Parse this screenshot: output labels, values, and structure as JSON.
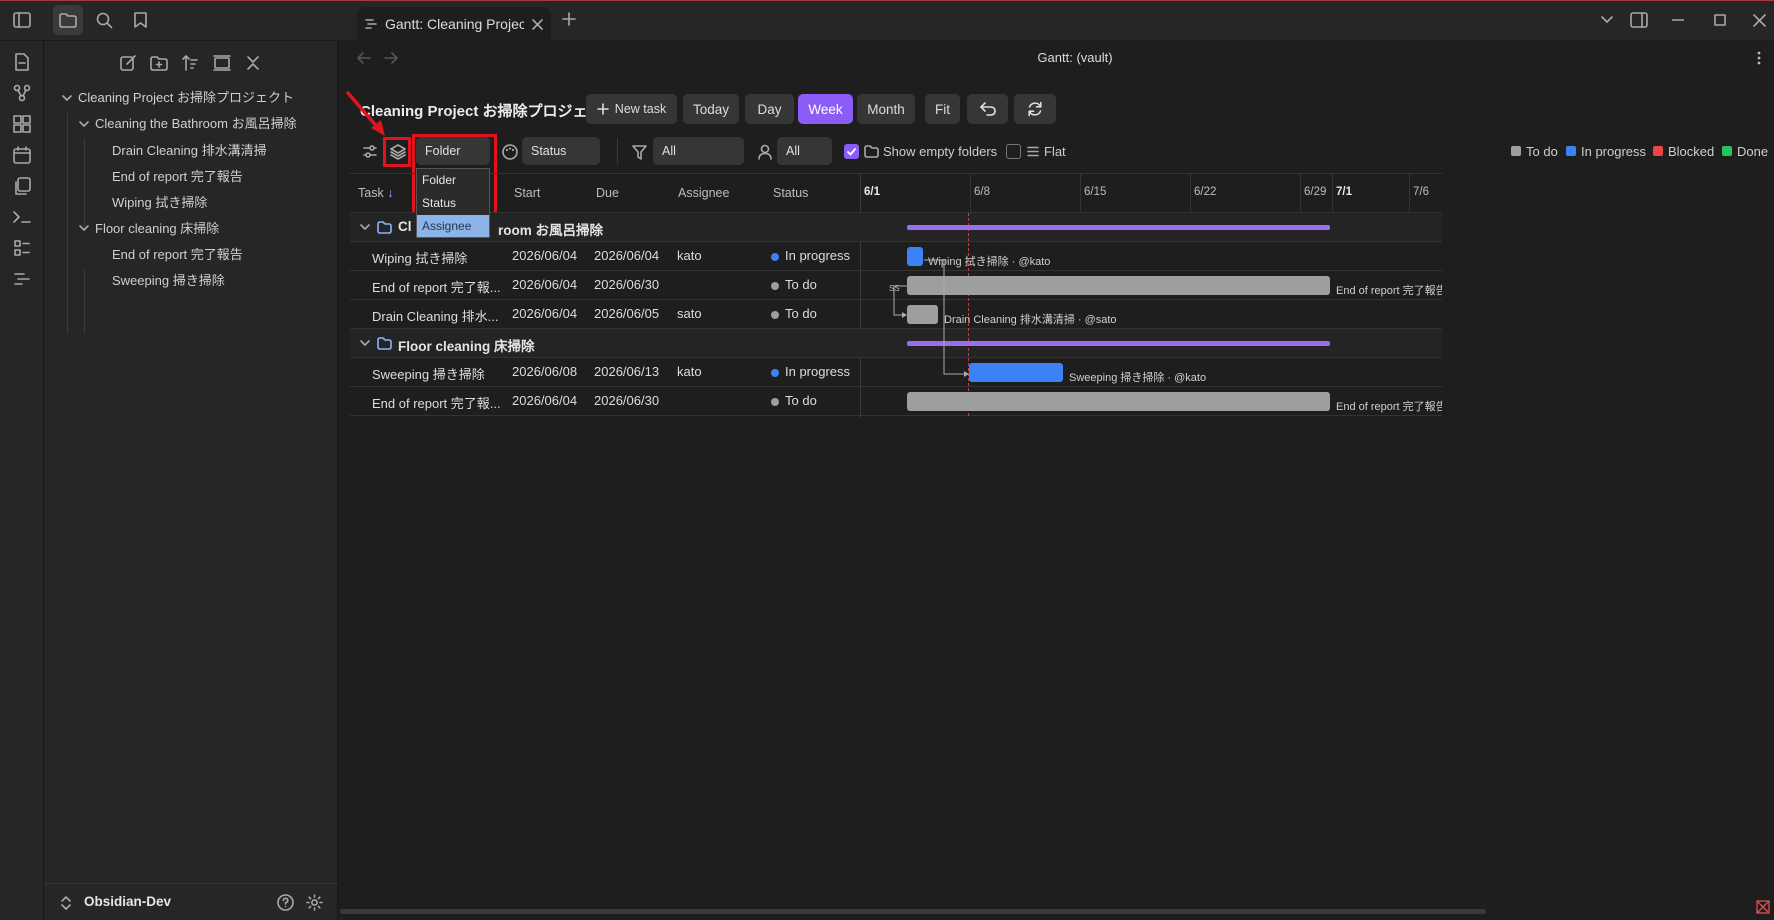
{
  "tab": {
    "title": "Gantt: Cleaning Project..."
  },
  "nav": {
    "title": "Gantt: (vault)"
  },
  "sidebar": {
    "tree": [
      {
        "label": "Cleaning Project お掃除プロジェクト"
      },
      {
        "label": "Cleaning the Bathroom お風呂掃除"
      },
      {
        "label": "Drain Cleaning 排水溝清掃"
      },
      {
        "label": "End of report 完了報告"
      },
      {
        "label": "Wiping 拭き掃除"
      },
      {
        "label": "Floor cleaning 床掃除"
      },
      {
        "label": "End of report 完了報告"
      },
      {
        "label": "Sweeping 掃き掃除"
      }
    ],
    "vault": "Obsidian-Dev"
  },
  "toolbar": {
    "title": "Cleaning Project お掃除プロジェクト",
    "new_task": "New task",
    "today": "Today",
    "day": "Day",
    "week": "Week",
    "month": "Month",
    "fit": "Fit"
  },
  "filters": {
    "group_by": "Folder",
    "color_by": "Status",
    "filter": "All",
    "assignee": "All",
    "show_empty_folders": "Show empty folders",
    "flat": "Flat",
    "group_options": [
      "Folder",
      "Status",
      "Assignee"
    ]
  },
  "legend": [
    {
      "label": "To do",
      "color": "#9e9e9e"
    },
    {
      "label": "In progress",
      "color": "#3b82f6"
    },
    {
      "label": "Blocked",
      "color": "#ef4444"
    },
    {
      "label": "Done",
      "color": "#22c55e"
    }
  ],
  "table": {
    "headers": {
      "task": "Task",
      "sort": "↓",
      "start": "Start",
      "due": "Due",
      "assignee": "Assignee",
      "status": "Status"
    },
    "groups": [
      {
        "label": "Cleaning the Bathroom お風呂掃除",
        "visible_label": "room お風呂掃除",
        "cl": "Cl"
      },
      {
        "label": "Floor cleaning 床掃除"
      }
    ],
    "rows": [
      {
        "task": "Wiping 拭き掃除",
        "start": "2026/06/04",
        "due": "2026/06/04",
        "assignee": "kato",
        "status": "In progress",
        "status_color": "#3b82f6"
      },
      {
        "task": "End of report 完了報...",
        "start": "2026/06/04",
        "due": "2026/06/30",
        "assignee": "",
        "status": "To do",
        "status_color": "#9e9e9e"
      },
      {
        "task": "Drain Cleaning 排水...",
        "start": "2026/06/04",
        "due": "2026/06/05",
        "assignee": "sato",
        "status": "To do",
        "status_color": "#9e9e9e"
      },
      {
        "task": "Sweeping 掃き掃除",
        "start": "2026/06/08",
        "due": "2026/06/13",
        "assignee": "kato",
        "status": "In progress",
        "status_color": "#3b82f6"
      },
      {
        "task": "End of report 完了報...",
        "start": "2026/06/04",
        "due": "2026/06/30",
        "assignee": "",
        "status": "To do",
        "status_color": "#9e9e9e"
      }
    ]
  },
  "timeline": {
    "headers": [
      "6/1",
      "6/8",
      "6/15",
      "6/22",
      "6/29",
      "7/1",
      "7/6"
    ],
    "bar_labels": [
      "Wiping 拭き掃除 · @kato",
      "End of report 完了報告",
      "Drain Cleaning 排水溝清掃 · @sato",
      "Sweeping 掃き掃除 · @kato",
      "End of report 完了報告"
    ],
    "dependency_label": "SS"
  }
}
